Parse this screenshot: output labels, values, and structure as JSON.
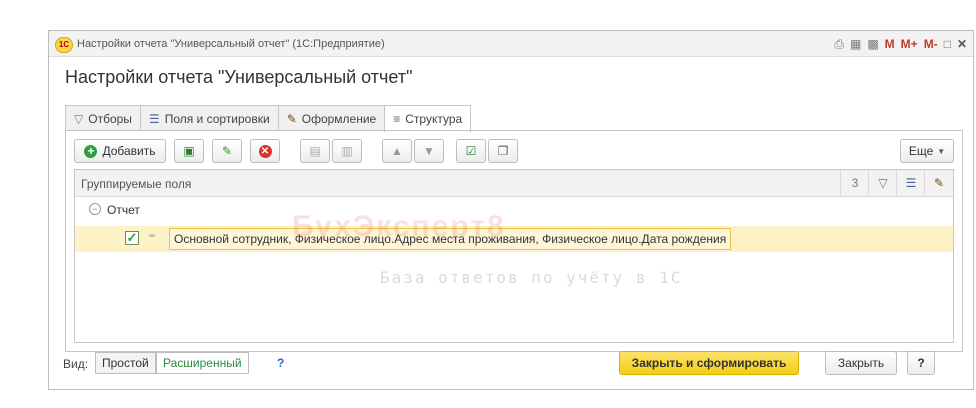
{
  "window": {
    "title": "Настройки отчета \"Универсальный отчет\"  (1С:Предприятие)",
    "controls": [
      "M",
      "M+",
      "M-"
    ]
  },
  "page_title": "Настройки отчета \"Универсальный отчет\"",
  "tabs": [
    {
      "label": "Отборы"
    },
    {
      "label": "Поля и сортировки"
    },
    {
      "label": "Оформление"
    },
    {
      "label": "Структура",
      "active": true
    }
  ],
  "toolbar": {
    "add_label": "Добавить",
    "more_label": "Еще"
  },
  "grid": {
    "column_title": "Группируемые поля",
    "count": "3",
    "rows": [
      {
        "label": "Отчет"
      },
      {
        "label": "Основной сотрудник, Физическое лицо.Адрес места проживания, Физическое лицо.Дата рождения",
        "checked": true
      }
    ]
  },
  "footer": {
    "view_label": "Вид:",
    "view_simple": "Простой",
    "view_extended": "Расширенный",
    "help_link": "?",
    "generate_button": "Закрыть и сформировать",
    "close_button": "Закрыть",
    "help_button": "?"
  },
  "watermark": {
    "brand": "БухЭксперт8",
    "slogan": "База ответов по учёту в 1С"
  },
  "colors": {
    "accent_yellow": "#f9d41e",
    "selected_row": "#fdf1c6",
    "link_green": "#2a8a3e"
  }
}
